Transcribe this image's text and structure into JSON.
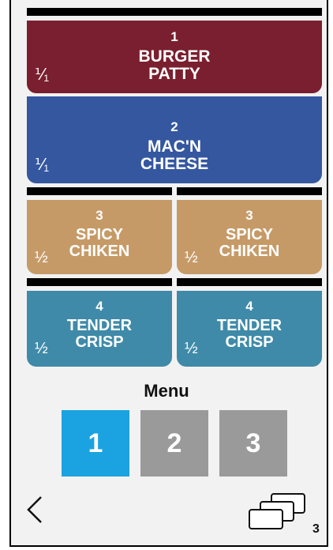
{
  "tiles": [
    {
      "number": "1",
      "name_line1": "BURGER",
      "name_line2": "PATTY",
      "portion": "⅟₁",
      "color": "#7a1f2f"
    },
    {
      "number": "2",
      "name_line1": "MAC'N",
      "name_line2": "CHEESE",
      "portion": "⅟₁",
      "color": "#3457a0"
    },
    {
      "number": "3",
      "name_line1": "SPICY",
      "name_line2": "CHIKEN",
      "portion": "½",
      "color": "#c69a67"
    },
    {
      "number": "3",
      "name_line1": "SPICY",
      "name_line2": "CHIKEN",
      "portion": "½",
      "color": "#c69a67"
    },
    {
      "number": "4",
      "name_line1": "TENDER",
      "name_line2": "CRISP",
      "portion": "½",
      "color": "#3f8aa8"
    },
    {
      "number": "4",
      "name_line1": "TENDER",
      "name_line2": "CRISP",
      "portion": "½",
      "color": "#3f8aa8"
    }
  ],
  "menu": {
    "title": "Menu",
    "pages": [
      {
        "label": "1",
        "active": true
      },
      {
        "label": "2",
        "active": false
      },
      {
        "label": "3",
        "active": false
      }
    ]
  },
  "footer": {
    "back_icon": "chevron-left-icon",
    "windows_icon": "stacked-windows-icon",
    "windows_count": "3"
  },
  "colors": {
    "active_page": "#1aa3e0",
    "inactive_page": "#9a9a9a"
  }
}
